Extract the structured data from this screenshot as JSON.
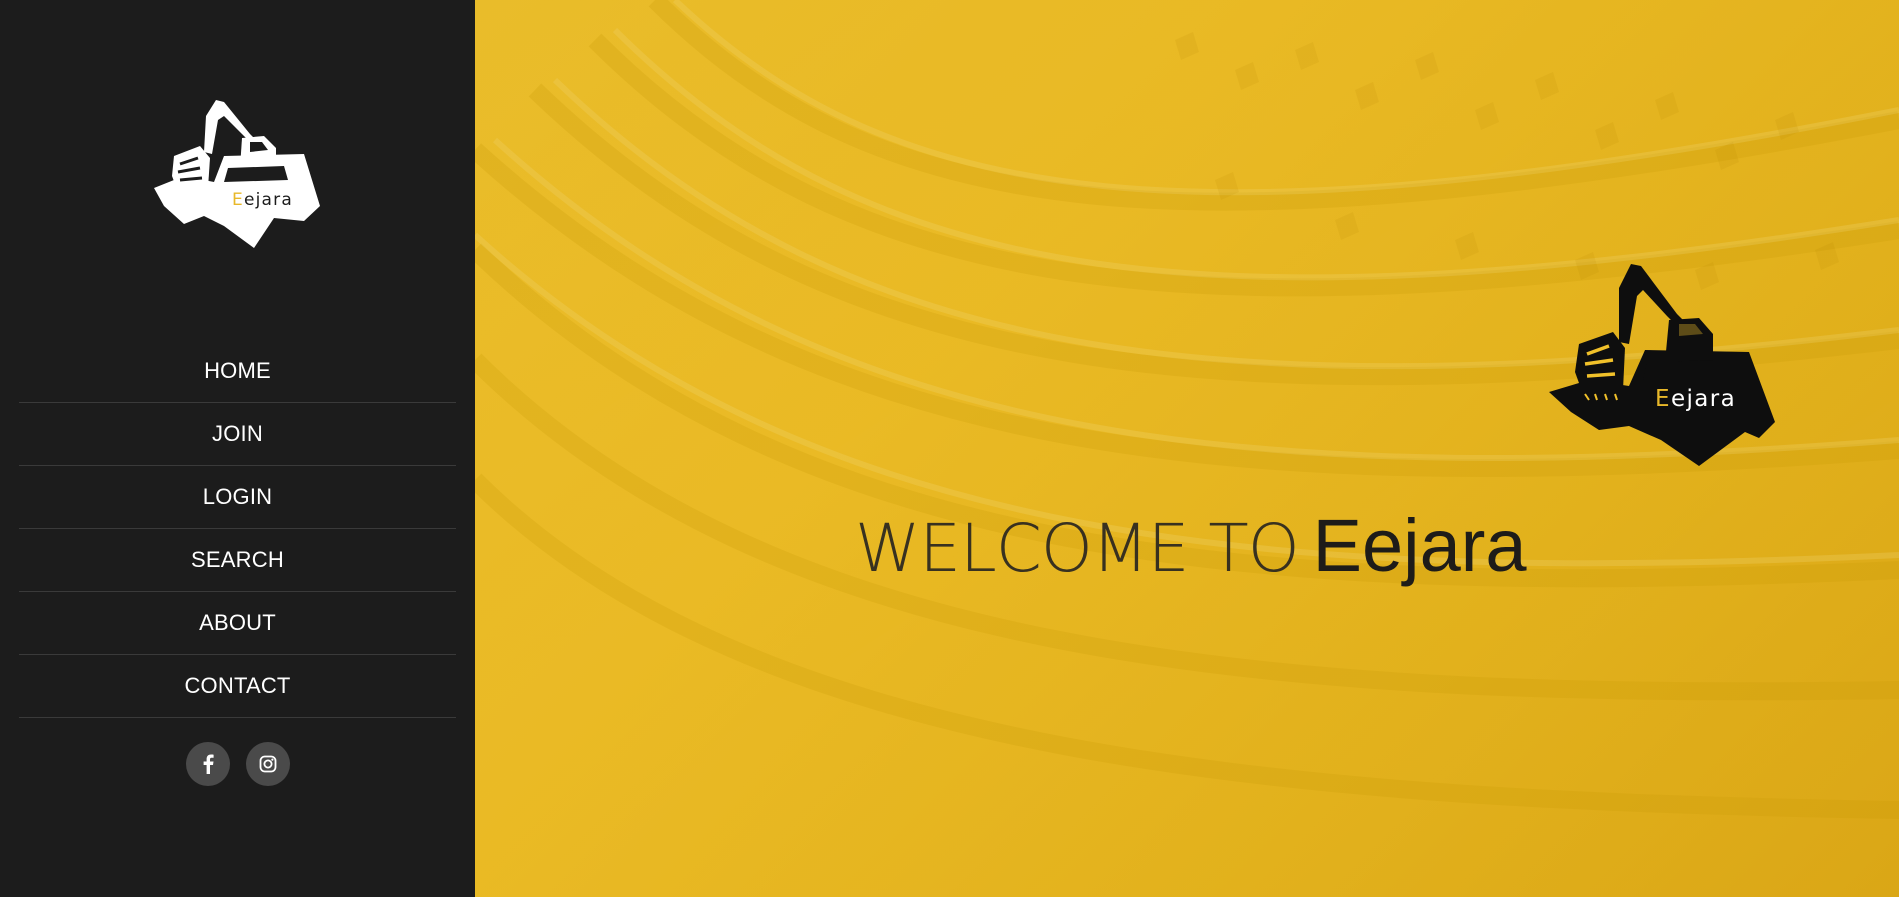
{
  "sidebar": {
    "logo": {
      "text_initial": "E",
      "text_rest": "ejara",
      "icon": "excavator-logo-icon"
    },
    "nav": [
      {
        "label": "HOME"
      },
      {
        "label": "JOIN"
      },
      {
        "label": "LOGIN"
      },
      {
        "label": "SEARCH"
      },
      {
        "label": "ABOUT"
      },
      {
        "label": "CONTACT"
      }
    ],
    "socials": [
      {
        "icon": "facebook-icon"
      },
      {
        "icon": "instagram-icon"
      }
    ]
  },
  "hero": {
    "logo": {
      "text_initial": "E",
      "text_rest": "ejara",
      "icon": "excavator-logo-icon"
    },
    "title_light": "WELCOME TO",
    "title_bold": "Eejara"
  },
  "colors": {
    "sidebar_bg": "#1c1c1c",
    "hero_yellow": "#f1c12a",
    "accent_yellow": "#e8b82a",
    "text_dark": "#1e1c19",
    "text_light": "#ffffff"
  }
}
